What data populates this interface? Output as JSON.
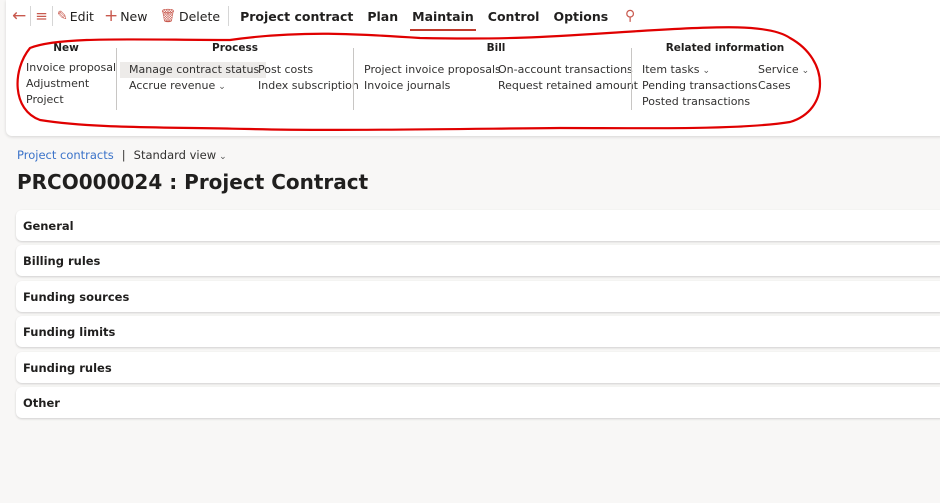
{
  "toolbar": {
    "back_icon": "arrow-left-icon",
    "menu_icon": "hamburger-icon",
    "edit_label": "Edit",
    "new_label": "New",
    "delete_label": "Delete",
    "tabs": [
      {
        "label": "Project contract",
        "active": false
      },
      {
        "label": "Plan",
        "active": false
      },
      {
        "label": "Maintain",
        "active": true
      },
      {
        "label": "Control",
        "active": false
      },
      {
        "label": "Options",
        "active": false
      }
    ],
    "search_icon": "search-icon"
  },
  "ribbon": {
    "new": {
      "title": "New",
      "items": [
        "Invoice proposal",
        "Adjustment",
        "Project"
      ]
    },
    "process": {
      "title": "Process",
      "col1": [
        {
          "label": "Manage contract status",
          "highlighted": true,
          "dropdown": false
        },
        {
          "label": "Accrue revenue",
          "highlighted": false,
          "dropdown": true
        }
      ],
      "col2": [
        {
          "label": "Post costs"
        },
        {
          "label": "Index subscription"
        }
      ]
    },
    "bill": {
      "title": "Bill",
      "col1": [
        "Project invoice proposals",
        "Invoice journals"
      ],
      "col2": [
        "On-account transactions",
        "Request retained amount"
      ]
    },
    "related": {
      "title": "Related information",
      "col1": [
        {
          "label": "Item tasks",
          "dropdown": true
        },
        {
          "label": "Pending transactions",
          "dropdown": false
        },
        {
          "label": "Posted transactions",
          "dropdown": false
        }
      ],
      "col2": [
        {
          "label": "Service",
          "dropdown": true
        },
        {
          "label": "Cases",
          "dropdown": false
        }
      ]
    }
  },
  "breadcrumb": {
    "link": "Project contracts",
    "separator": "|",
    "view": "Standard view"
  },
  "page_title": "PRCO000024 : Project Contract",
  "fasttabs": [
    "General",
    "Billing rules",
    "Funding sources",
    "Funding limits",
    "Funding rules",
    "Other"
  ],
  "colors": {
    "accent": "#c0392b",
    "icon": "#c8594e",
    "link": "#3b73c9",
    "annotation": "#e00000"
  }
}
